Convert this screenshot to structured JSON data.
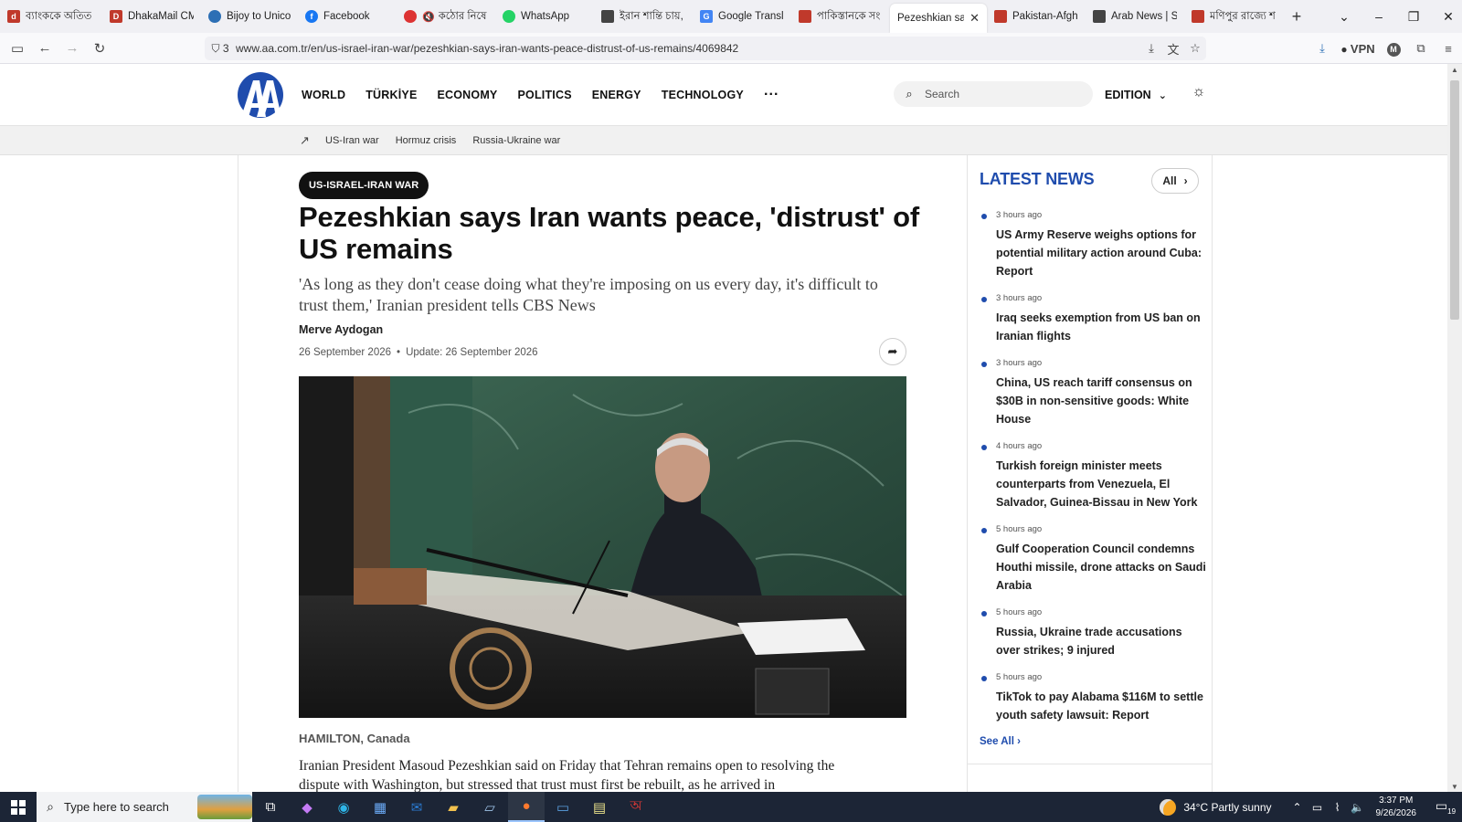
{
  "browser": {
    "tabs": [
      {
        "label": "ব্যাংককে অতিত",
        "color": "#c0392b"
      },
      {
        "label": "DhakaMail CMS",
        "color": "#c0392b"
      },
      {
        "label": "Bijoy to Unicode",
        "color": "#2c6fb5"
      },
      {
        "label": "Facebook",
        "color": "#1877f2"
      },
      {
        "label": "কঠোর নিষে",
        "color": "#d33"
      },
      {
        "label": "WhatsApp",
        "color": "#25d366"
      },
      {
        "label": "ইরান শান্তি চায়,",
        "color": "#444"
      },
      {
        "label": "Google Translate",
        "color": "#4285f4"
      },
      {
        "label": "পাকিস্তানকে সং",
        "color": "#c0392b"
      },
      {
        "label": "Pezeshkian says Ir",
        "color": "#ffffff",
        "active": true
      },
      {
        "label": "Pakistan-Afghan",
        "color": "#c0392b"
      },
      {
        "label": "Arab News | Spa",
        "color": "#444"
      },
      {
        "label": "মণিপুর রাজ্যে শ",
        "color": "#c0392b"
      }
    ],
    "url": "www.aa.com.tr/en/us-israel-iran-war/pezeshkian-says-iran-wants-peace-distrust-of-us-remains/4069842",
    "shield_count": "3",
    "vpn_label": "VPN",
    "profile_initial": "M"
  },
  "site": {
    "logo_text": "AA",
    "nav": [
      "WORLD",
      "TÜRKİYE",
      "ECONOMY",
      "POLITICS",
      "ENERGY",
      "TECHNOLOGY"
    ],
    "nav_more": "···",
    "search_placeholder": "Search",
    "edition_label": "EDITION",
    "trending": [
      "US-Iran war",
      "Hormuz crisis",
      "Russia-Ukraine war"
    ]
  },
  "article": {
    "category": "US-ISRAEL-IRAN WAR",
    "headline": "Pezeshkian says Iran wants peace, 'distrust' of US remains",
    "subtitle": "'As long as they don't cease doing what they're imposing on us every day, it's difficult to trust them,' Iranian president tells CBS News",
    "author": "Merve Aydogan",
    "date": "26 September 2026",
    "update": "Update: 26 September 2026",
    "dateline": "HAMILTON, Canada",
    "body": "Iranian President Masoud Pezeshkian said on Friday that Tehran remains open to resolving the dispute with Washington, but stressed that trust must first be rebuilt, as he arrived in"
  },
  "sidebar": {
    "title": "LATEST NEWS",
    "all_label": "All",
    "see_all": "See All",
    "items": [
      {
        "time": "3 hours ago",
        "title": "US Army Reserve weighs options for potential military action around Cuba: Report"
      },
      {
        "time": "3 hours ago",
        "title": "Iraq seeks exemption from US ban on Iranian flights"
      },
      {
        "time": "3 hours ago",
        "title": "China, US reach tariff consensus on $30B in non-sensitive goods: White House"
      },
      {
        "time": "4 hours ago",
        "title": "Turkish foreign minister meets counterparts from Venezuela, El Salvador, Guinea-Bissau in New York"
      },
      {
        "time": "5 hours ago",
        "title": "Gulf Cooperation Council condemns Houthi missile, drone attacks on Saudi Arabia"
      },
      {
        "time": "5 hours ago",
        "title": "Russia, Ukraine trade accusations over strikes; 9 injured"
      },
      {
        "time": "5 hours ago",
        "title": "TikTok to pay Alabama $116M to settle youth safety lawsuit: Report"
      }
    ]
  },
  "taskbar": {
    "search_placeholder": "Type here to search",
    "weather": "34°C  Partly sunny",
    "time": "3:37 PM",
    "date": "9/26/2026",
    "notification_count": "19"
  },
  "colors": {
    "brand_blue": "#1f4cad",
    "badge_bg": "#111111"
  }
}
